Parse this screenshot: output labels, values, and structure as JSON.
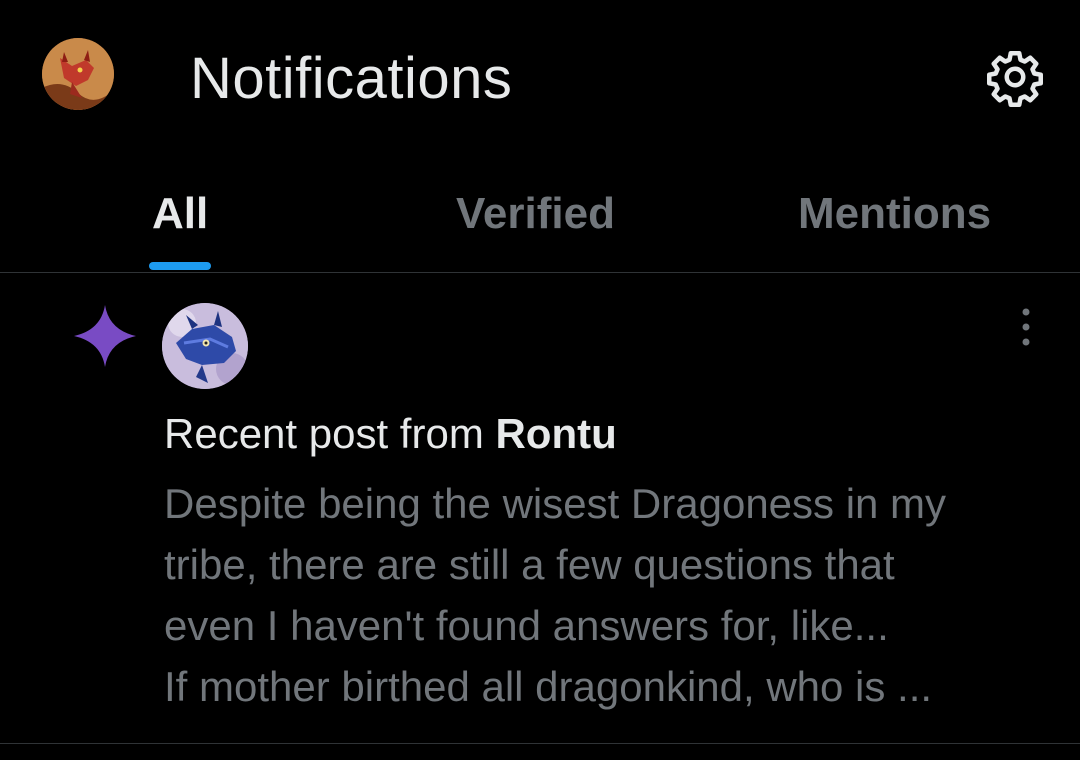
{
  "header": {
    "title": "Notifications",
    "avatar_icon": "dragon-avatar-icon",
    "settings_icon": "gear-icon"
  },
  "tabs": [
    {
      "label": "All",
      "active": true
    },
    {
      "label": "Verified",
      "active": false
    },
    {
      "label": "Mentions",
      "active": false
    }
  ],
  "colors": {
    "background": "#000000",
    "text_primary": "#e7e9ea",
    "text_secondary": "#71767b",
    "accent": "#1d9bf0",
    "sparkle": "#794bc4",
    "divider": "#2f3336"
  },
  "notification": {
    "icon": "sparkle-icon",
    "headline_prefix": "Recent post from ",
    "author": "Rontu",
    "body_lines": [
      "Despite being the wisest Dragoness in my",
      "tribe, there are still a few questions that",
      "even I haven't found answers for, like...",
      "If mother birthed all dragonkind, who is ..."
    ],
    "more_icon": "more-vertical-icon"
  }
}
